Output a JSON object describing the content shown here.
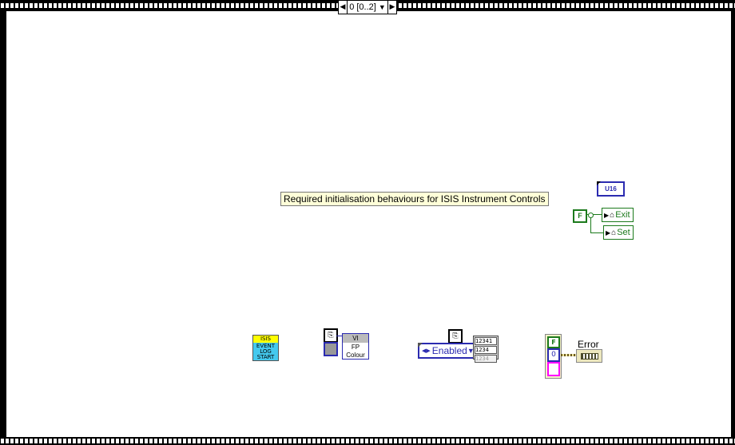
{
  "case_selector": {
    "value": "0 [0..2]",
    "prev_icon": "left-triangle-icon",
    "next_icon": "right-triangle-icon",
    "dropdown_icon": "down-triangle-icon"
  },
  "comment": "Required initialisation behaviours for ISIS Instrument Controls",
  "u16_constant": "U16",
  "false_constant": "F",
  "property_nodes": {
    "exit": "Exit",
    "set": "Set"
  },
  "isis_vi": {
    "top": "ISIS",
    "bottom_lines": [
      "EVENT",
      "LOG",
      "START"
    ]
  },
  "fp_colour_vi": {
    "header": "VI",
    "lines": [
      "FP",
      "Colour"
    ]
  },
  "enum_constant": "Enabled",
  "array_indicator": [
    "12341",
    "1234",
    "1234"
  ],
  "cluster": {
    "bool": "F",
    "num": "0"
  },
  "error_label": "Error",
  "colors": {
    "wire_bool": "#1c7a1c",
    "wire_num": "#2b2bb0",
    "string_pink": "#ff00ff",
    "isis_yellow": "#ffff00",
    "isis_cyan": "#44c9ee"
  }
}
